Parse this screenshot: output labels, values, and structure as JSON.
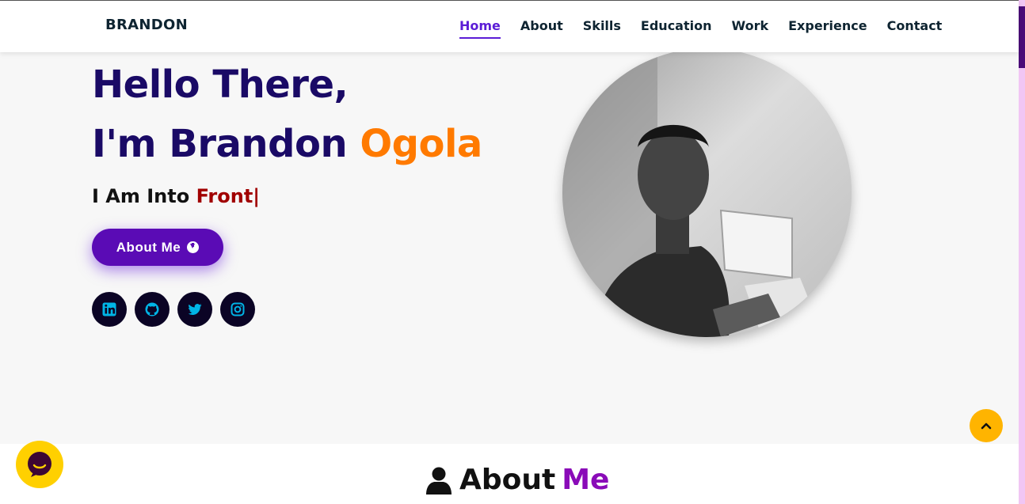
{
  "brand": "BRANDON",
  "nav": {
    "items": [
      "Home",
      "About",
      "Skills",
      "Education",
      "Work",
      "Experience",
      "Contact"
    ],
    "active": "Home"
  },
  "hero": {
    "greeting": "Hello There,",
    "name_prefix": "I'm Brandon ",
    "name_accent": "Ogola",
    "typing_prefix": "I Am Into ",
    "typing_value": "Front|",
    "cta_label": "About Me",
    "cta_icon": "arrow-circle-down-icon",
    "socials": [
      "linkedin-icon",
      "github-icon",
      "twitter-icon",
      "instagram-icon"
    ]
  },
  "about": {
    "title_prefix": "About ",
    "title_accent": "Me",
    "icon": "user-icon"
  },
  "colors": {
    "accent_purple": "#5a0bb5",
    "accent_orange": "#ff7a00",
    "heading_navy": "#1a0a66",
    "typed_red": "#a10000",
    "social_icon": "#00b4e6",
    "totop_yellow": "#ffb400",
    "chat_yellow": "#ffd000",
    "about_accent": "#8a0bb8"
  }
}
